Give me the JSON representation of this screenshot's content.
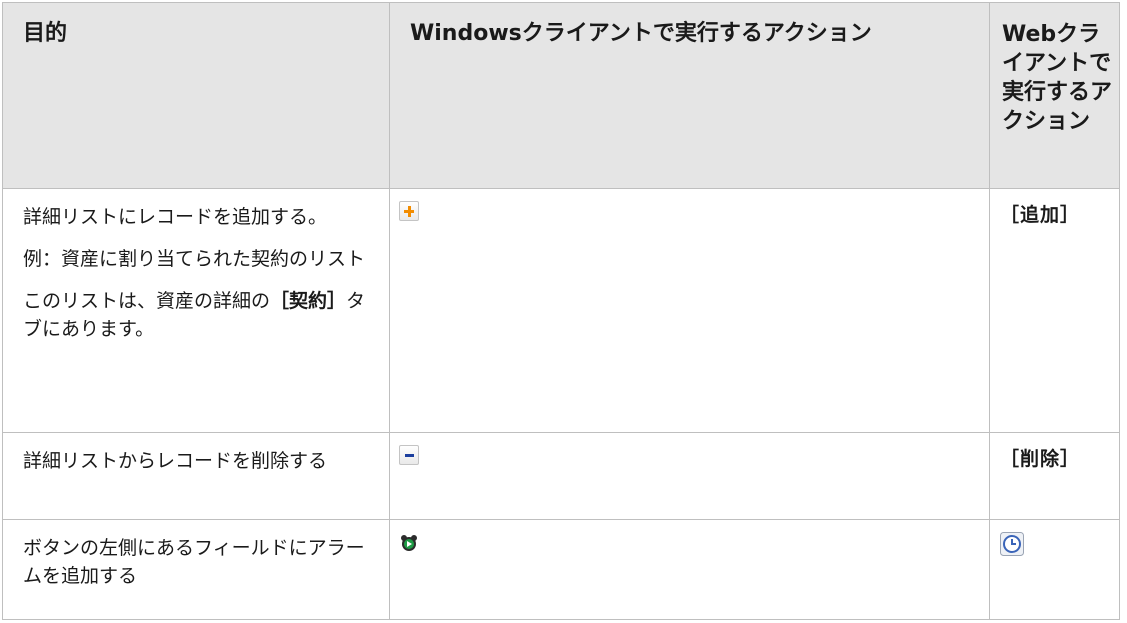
{
  "table": {
    "headers": [
      "目的",
      "Windowsクライアントで実行するアクション",
      "Webクライアントで実行するアクション"
    ],
    "rows": [
      {
        "purpose": [
          "詳細リストにレコードを追加する。",
          "例：資産に割り当てられた契約のリスト"
        ],
        "purpose_note_prefix": "このリストは、資産の詳細の",
        "purpose_note_bold": "［契約］",
        "purpose_note_suffix": "タブにあります。",
        "windows_icon": "add-plus-icon",
        "web_action": "［追加］"
      },
      {
        "purpose": [
          "詳細リストからレコードを削除する"
        ],
        "windows_icon": "remove-minus-icon",
        "web_action": "［削除］"
      },
      {
        "purpose": [
          "ボタンの左側にあるフィールドにアラームを追加する"
        ],
        "windows_icon": "alarm-clock-icon",
        "web_icon": "clock-icon"
      }
    ]
  },
  "colors": {
    "header_bg": "#e5e5e5",
    "border": "#bfbfbf",
    "plus": "#f28c00",
    "minus": "#1c3f9e",
    "alarm_green": "#1e9c45",
    "clock_blue": "#3a64b8"
  }
}
